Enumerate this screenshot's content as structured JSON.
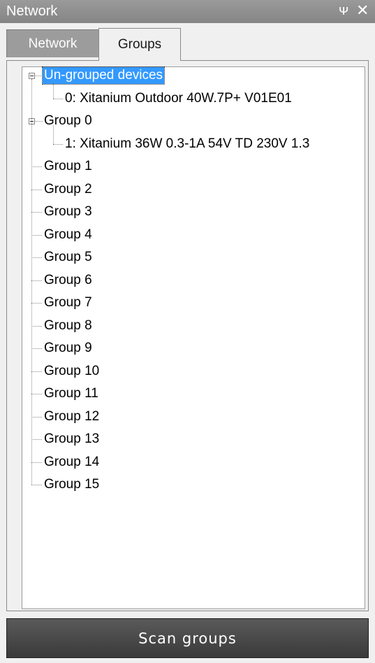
{
  "panel": {
    "title": "Network",
    "pin_glyph": "ᴪ",
    "close_glyph": "✕"
  },
  "tabs": [
    {
      "label": "Network",
      "active": false
    },
    {
      "label": "Groups",
      "active": true
    }
  ],
  "tree": {
    "nodes": [
      {
        "label": "Un-grouped devices",
        "expanded": true,
        "selected": true,
        "children": [
          "0: Xitanium Outdoor 40W.7P+ V01E01"
        ]
      },
      {
        "label": "Group 0",
        "expanded": true,
        "selected": false,
        "children": [
          "1: Xitanium 36W 0.3-1A 54V TD 230V 1.3"
        ]
      },
      {
        "label": "Group 1"
      },
      {
        "label": "Group 2"
      },
      {
        "label": "Group 3"
      },
      {
        "label": "Group 4"
      },
      {
        "label": "Group 5"
      },
      {
        "label": "Group 6"
      },
      {
        "label": "Group 7"
      },
      {
        "label": "Group 8"
      },
      {
        "label": "Group 9"
      },
      {
        "label": "Group 10"
      },
      {
        "label": "Group 11"
      },
      {
        "label": "Group 12"
      },
      {
        "label": "Group 13"
      },
      {
        "label": "Group 14"
      },
      {
        "label": "Group 15"
      }
    ]
  },
  "actions": {
    "scan_label": "Scan groups"
  },
  "colors": {
    "selection": "#3399ff",
    "titlebar": "#8f8f8f",
    "button": "#454545"
  }
}
